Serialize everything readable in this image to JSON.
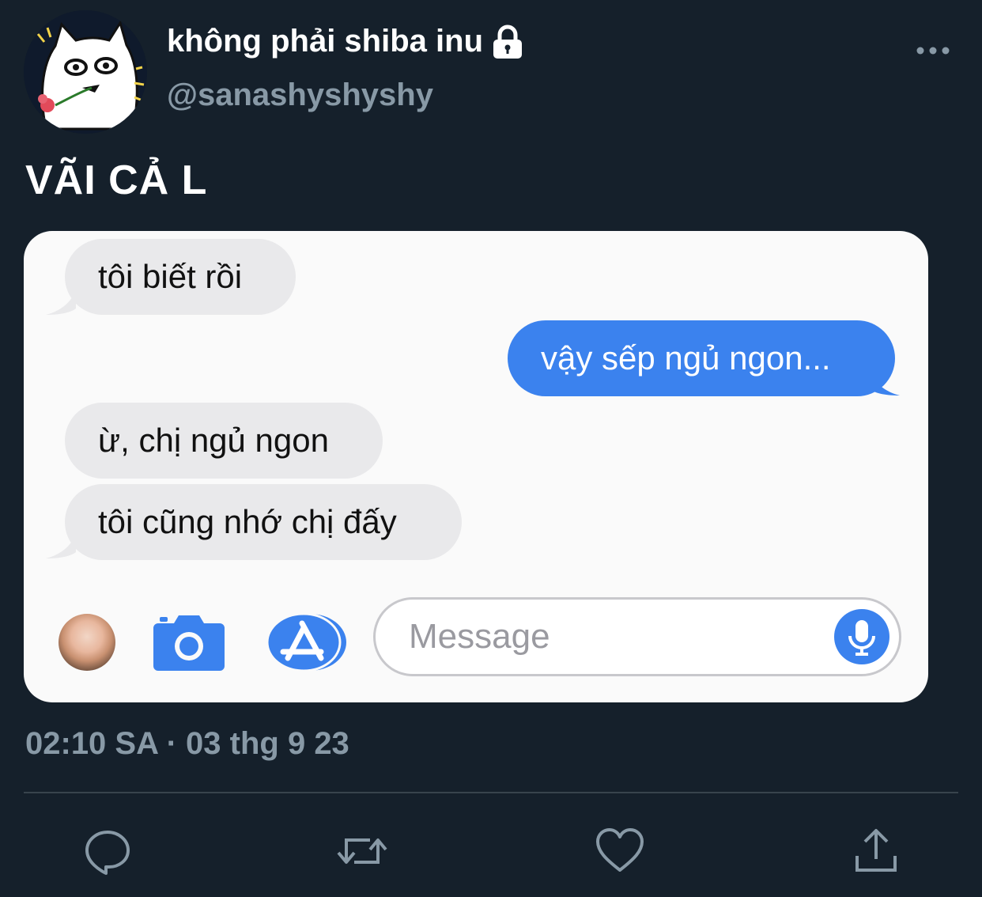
{
  "user": {
    "display_name": "không phải shiba inu",
    "handle": "@sanashyshyshy",
    "avatar_icon": "cartoon-cat-avatar",
    "protected_icon": "lock-icon"
  },
  "tweet": {
    "text": "VÃI CẢ L",
    "timestamp": "02:10 SA · 03 thg 9 23"
  },
  "media": {
    "messages": [
      {
        "direction": "incoming",
        "text": "tôi biết rồi"
      },
      {
        "direction": "outgoing",
        "text": "vậy sếp ngủ ngon..."
      },
      {
        "direction": "incoming",
        "text": "ừ, chị ngủ ngon"
      },
      {
        "direction": "incoming",
        "text": "tôi cũng nhớ chị đấy"
      }
    ],
    "composer": {
      "placeholder": "Message",
      "icons": [
        "contact-avatar",
        "camera-icon",
        "app-store-icon",
        "microphone-icon"
      ]
    },
    "colors": {
      "outgoing_bubble": "#3b82ee",
      "incoming_bubble": "#e9e9eb"
    }
  },
  "actions": [
    "reply-icon",
    "retweet-icon",
    "like-icon",
    "share-icon"
  ],
  "colors": {
    "background": "#15202b",
    "secondary_text": "#8899a6"
  }
}
